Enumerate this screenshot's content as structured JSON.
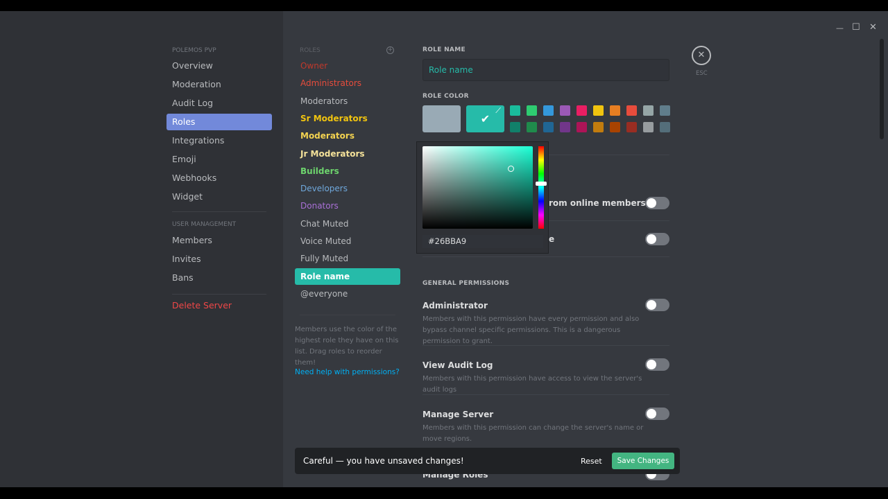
{
  "window": {
    "minimize": "—",
    "maximize": "☐",
    "close": "✕"
  },
  "sidebar": {
    "server_header": "POLEMOS PVP",
    "items": [
      {
        "label": "Overview"
      },
      {
        "label": "Moderation"
      },
      {
        "label": "Audit Log"
      },
      {
        "label": "Roles",
        "active": true
      },
      {
        "label": "Integrations"
      },
      {
        "label": "Emoji"
      },
      {
        "label": "Webhooks"
      },
      {
        "label": "Widget"
      }
    ],
    "user_mgmt_header": "USER MANAGEMENT",
    "user_items": [
      {
        "label": "Members"
      },
      {
        "label": "Invites"
      },
      {
        "label": "Bans"
      }
    ],
    "delete": "Delete Server"
  },
  "roles": {
    "header": "ROLES",
    "items": [
      {
        "label": "Owner",
        "color": "#c0392b"
      },
      {
        "label": "Administrators",
        "color": "#e74c3c"
      },
      {
        "label": "Moderators",
        "color": "#b9bbbe"
      },
      {
        "label": "Sr Moderators",
        "color": "#f1c40f"
      },
      {
        "label": "Moderators",
        "color": "#f3d250"
      },
      {
        "label": "Jr Moderators",
        "color": "#f5e29a"
      },
      {
        "label": "Builders",
        "color": "#6dd46d"
      },
      {
        "label": "Developers",
        "color": "#6fa8dc"
      },
      {
        "label": "Donators",
        "color": "#a970d6"
      },
      {
        "label": "Chat Muted",
        "color": "#b9bbbe"
      },
      {
        "label": "Voice Muted",
        "color": "#b9bbbe"
      },
      {
        "label": "Fully Muted",
        "color": "#b9bbbe"
      },
      {
        "label": "Role name",
        "color": "#ffffff",
        "selected": true
      },
      {
        "label": "@everyone",
        "color": "#b9bbbe"
      }
    ],
    "hint": "Members use the color of the highest role they have on this list. Drag roles to reorder them!",
    "help_link": "Need help with permissions?"
  },
  "editor": {
    "role_name_label": "ROLE NAME",
    "role_name_value": "Role name",
    "role_color_label": "ROLE COLOR",
    "default_color": "#99aab5",
    "custom_color": "#26bba9",
    "swatches_top": [
      "#1abc9c",
      "#2ecc71",
      "#3498db",
      "#9b59b6",
      "#e91e63",
      "#f1c40f",
      "#e67e22",
      "#e74c3c",
      "#95a5a6",
      "#607d8b"
    ],
    "swatches_bottom": [
      "#11806a",
      "#1f8b4c",
      "#206694",
      "#71368a",
      "#ad1457",
      "#c27c0e",
      "#a84300",
      "#992d22",
      "#979c9f",
      "#546e7a"
    ],
    "picker_hex": "#26BBA9",
    "hidden_toggle_1": "rom online members",
    "hidden_toggle_2": "e",
    "general_permissions": "GENERAL PERMISSIONS",
    "permissions": [
      {
        "title": "Administrator",
        "desc": "Members with this permission have every permission and also bypass channel specific permissions. This is a dangerous permission to grant."
      },
      {
        "title": "View Audit Log",
        "desc": "Members with this permission have access to view the server's audit logs"
      },
      {
        "title": "Manage Server",
        "desc": "Members with this permission can change the server's name or move regions."
      },
      {
        "title": "Manage Roles",
        "desc": ""
      }
    ],
    "esc": "ESC"
  },
  "notice": {
    "text": "Careful — you have unsaved changes!",
    "reset": "Reset",
    "save": "Save Changes"
  }
}
